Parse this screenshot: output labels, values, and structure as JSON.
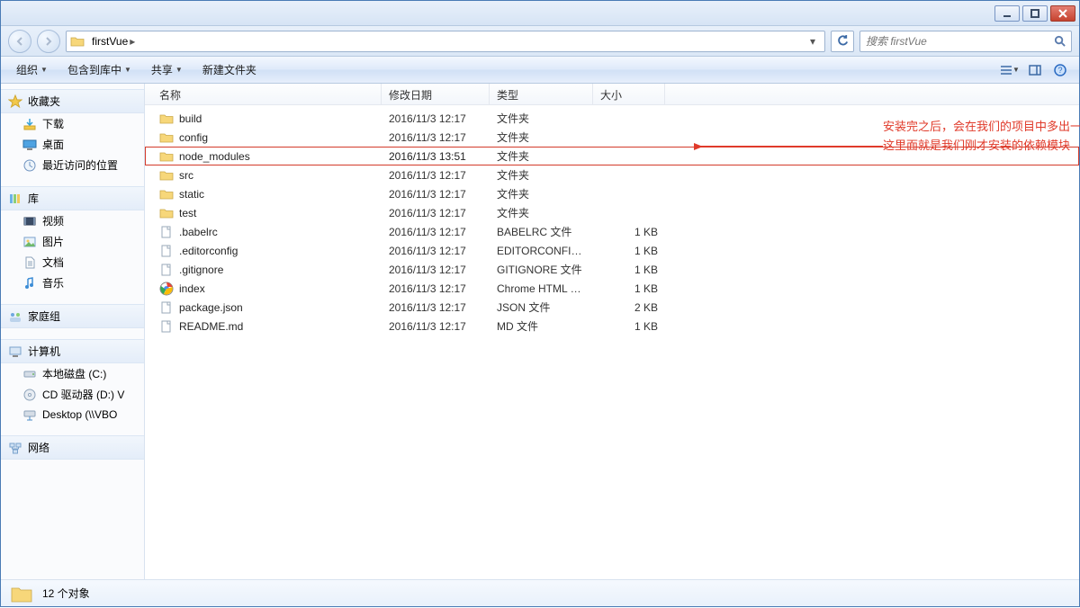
{
  "breadcrumb": {
    "folder": "firstVue"
  },
  "search": {
    "placeholder": "搜索 firstVue"
  },
  "toolbar": {
    "organize": "组织",
    "include": "包含到库中",
    "share": "共享",
    "newfolder": "新建文件夹"
  },
  "columns": {
    "name": "名称",
    "date": "修改日期",
    "type": "类型",
    "size": "大小"
  },
  "sidebar": {
    "favorites": "收藏夹",
    "fav": {
      "downloads": "下载",
      "desktop": "桌面",
      "recent": "最近访问的位置"
    },
    "libraries": "库",
    "lib": {
      "videos": "视频",
      "pictures": "图片",
      "documents": "文档",
      "music": "音乐"
    },
    "homegroup": "家庭组",
    "computer": "计算机",
    "comp": {
      "c": "本地磁盘 (C:)",
      "d": "CD 驱动器 (D:) V",
      "desktop": "Desktop (\\\\VBO"
    },
    "network": "网络"
  },
  "rows": [
    {
      "icon": "folder",
      "name": "build",
      "date": "2016/11/3 12:17",
      "type": "文件夹",
      "size": ""
    },
    {
      "icon": "folder",
      "name": "config",
      "date": "2016/11/3 12:17",
      "type": "文件夹",
      "size": ""
    },
    {
      "icon": "folder",
      "name": "node_modules",
      "date": "2016/11/3 13:51",
      "type": "文件夹",
      "size": "",
      "hl": true
    },
    {
      "icon": "folder",
      "name": "src",
      "date": "2016/11/3 12:17",
      "type": "文件夹",
      "size": ""
    },
    {
      "icon": "folder",
      "name": "static",
      "date": "2016/11/3 12:17",
      "type": "文件夹",
      "size": ""
    },
    {
      "icon": "folder",
      "name": "test",
      "date": "2016/11/3 12:17",
      "type": "文件夹",
      "size": ""
    },
    {
      "icon": "file",
      "name": ".babelrc",
      "date": "2016/11/3 12:17",
      "type": "BABELRC 文件",
      "size": "1 KB"
    },
    {
      "icon": "file",
      "name": ".editorconfig",
      "date": "2016/11/3 12:17",
      "type": "EDITORCONFIG ...",
      "size": "1 KB"
    },
    {
      "icon": "file",
      "name": ".gitignore",
      "date": "2016/11/3 12:17",
      "type": "GITIGNORE 文件",
      "size": "1 KB"
    },
    {
      "icon": "chrome",
      "name": "index",
      "date": "2016/11/3 12:17",
      "type": "Chrome HTML D...",
      "size": "1 KB"
    },
    {
      "icon": "file",
      "name": "package.json",
      "date": "2016/11/3 12:17",
      "type": "JSON 文件",
      "size": "2 KB"
    },
    {
      "icon": "file",
      "name": "README.md",
      "date": "2016/11/3 12:17",
      "type": "MD 文件",
      "size": "1 KB"
    }
  ],
  "annotation": {
    "line1": "安装完之后，会在我们的项目中多出一个文件夹，",
    "line2": "这里面就是我们刚才安装的依赖模块"
  },
  "status": {
    "count": "12 个对象"
  }
}
